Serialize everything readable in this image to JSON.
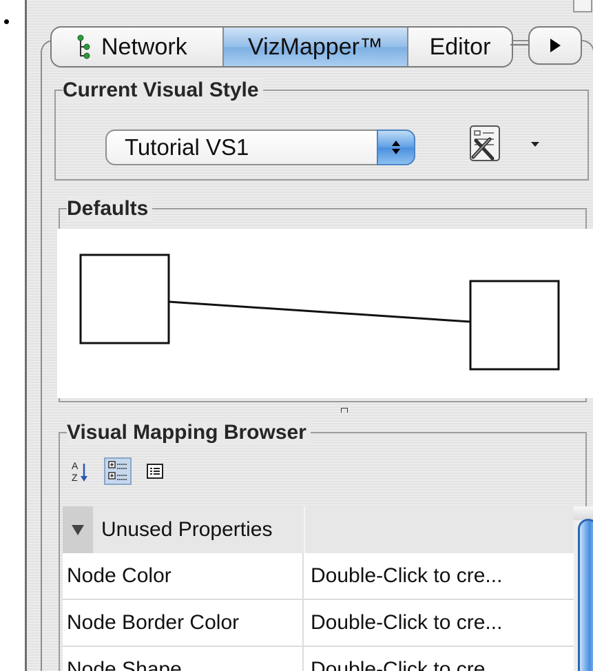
{
  "tabs": {
    "network": "Network",
    "vizmapper": "VizMapper™",
    "editor": "Editor",
    "more": "next-tab-arrow-icon"
  },
  "current_visual_style": {
    "legend": "Current Visual Style",
    "selected": "Tutorial VS1",
    "options_icon": "style-options-icon"
  },
  "defaults": {
    "legend": "Defaults"
  },
  "browser": {
    "legend": "Visual Mapping Browser",
    "toolbar": [
      "sort-az-icon",
      "categorized-view-icon",
      "list-view-icon"
    ],
    "category": "Unused Properties",
    "rows": [
      {
        "name": "Node Color",
        "value": "Double-Click to cre..."
      },
      {
        "name": "Node Border Color",
        "value": "Double-Click to cre..."
      },
      {
        "name": "Node Shape",
        "value": "Double-Click to cre..."
      }
    ]
  },
  "colors": {
    "active_tab": "#7db0e3",
    "scrollbar": "#4b8ddb"
  }
}
